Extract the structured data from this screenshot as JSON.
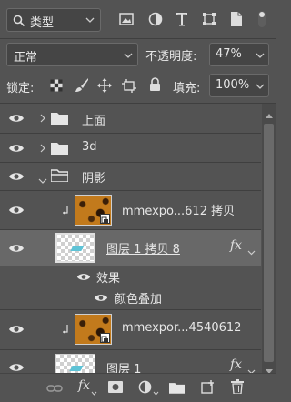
{
  "filter": {
    "icon": "search-icon",
    "label": "类型"
  },
  "blend": {
    "mode": "正常",
    "opacity_label": "不透明度:",
    "opacity_value": "47%"
  },
  "lock": {
    "label": "锁定:",
    "fill_label": "填充:",
    "fill_value": "100%"
  },
  "layers": [
    {
      "name": "上面",
      "type": "group"
    },
    {
      "name": "3d",
      "type": "group"
    },
    {
      "name": "阴影",
      "type": "group-open"
    },
    {
      "name": "mmexpo...612 拷贝",
      "type": "smart"
    },
    {
      "name": "图层 1 拷贝 8",
      "type": "layer",
      "fx": "fx",
      "selected": true
    },
    {
      "name": "效果",
      "type": "effects"
    },
    {
      "name": "颜色叠加",
      "type": "effect"
    },
    {
      "name": "mmexpor...4540612",
      "type": "smart"
    },
    {
      "name": "图层 1",
      "type": "layer",
      "fx": "fx"
    }
  ],
  "bottom": {
    "fx": "fx"
  },
  "colors": {
    "panel": "#535353",
    "selected_row": "#686868",
    "field": "#454545"
  }
}
